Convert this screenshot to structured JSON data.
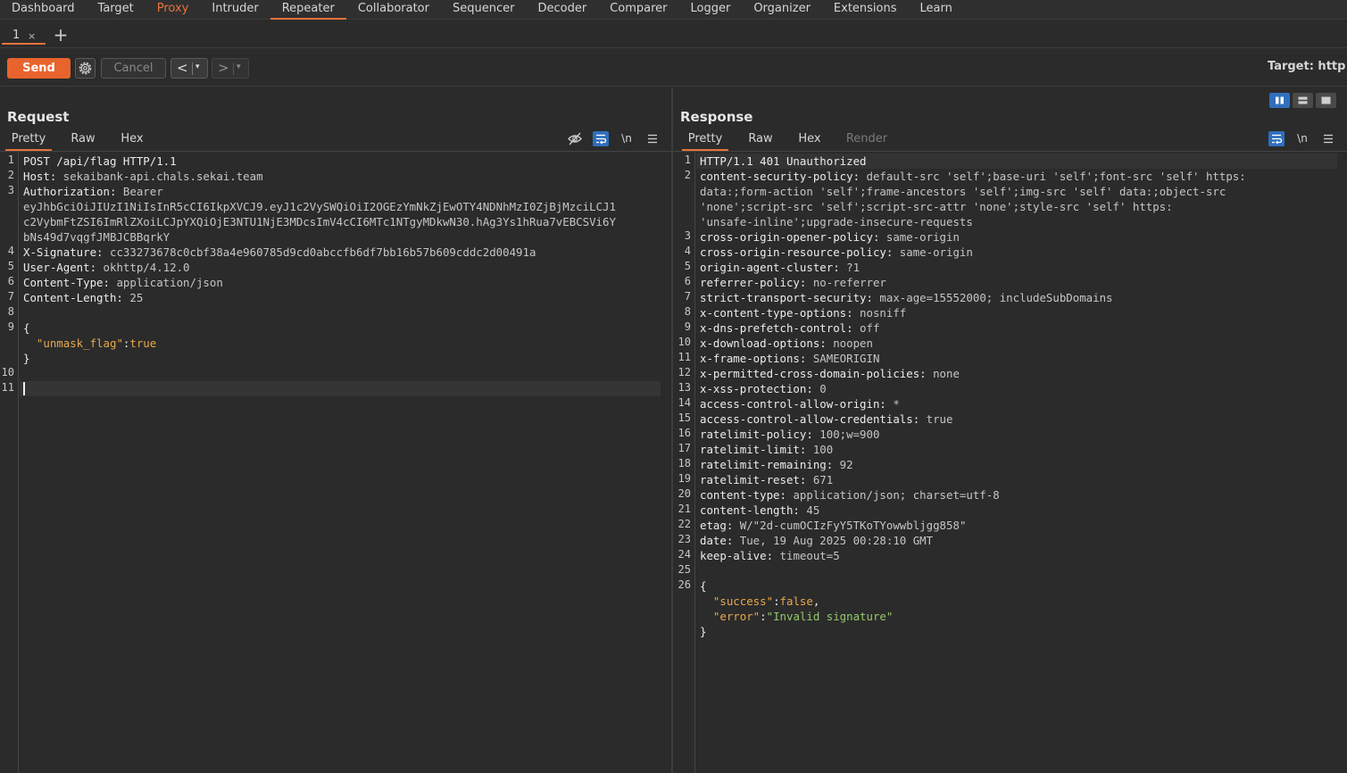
{
  "menu": {
    "items": [
      "Dashboard",
      "Target",
      "Proxy",
      "Intruder",
      "Repeater",
      "Collaborator",
      "Sequencer",
      "Decoder",
      "Comparer",
      "Logger",
      "Organizer",
      "Extensions",
      "Learn"
    ]
  },
  "repeater_tabs": [
    {
      "label": "1",
      "close": "×"
    }
  ],
  "add_tab": "+",
  "toolbar": {
    "send": "Send",
    "cancel": "Cancel",
    "back_arrow": "<",
    "fwd_arrow": ">",
    "dropdown": "▾",
    "target": "Target: http"
  },
  "request": {
    "title": "Request",
    "tabs": [
      "Pretty",
      "Raw",
      "Hex"
    ],
    "newline_label": "\\n",
    "lines": [
      {
        "n": "1",
        "parts": [
          {
            "t": "POST /api/flag HTTP/1.1",
            "c": "k"
          }
        ]
      },
      {
        "n": "2",
        "parts": [
          {
            "t": "Host: ",
            "c": "k"
          },
          {
            "t": "sekaibank-api.chals.sekai.team",
            "c": "v"
          }
        ]
      },
      {
        "n": "3",
        "parts": [
          {
            "t": "Authorization: ",
            "c": "k"
          },
          {
            "t": "Bearer",
            "c": "v"
          }
        ]
      },
      {
        "n": "",
        "parts": [
          {
            "t": "eyJhbGciOiJIUzI1NiIsInR5cCI6IkpXVCJ9.eyJ1c2VySWQiOiI2OGEzYmNkZjEwOTY4NDNhMzI0ZjBjMzciLCJ1",
            "c": "v"
          }
        ]
      },
      {
        "n": "",
        "parts": [
          {
            "t": "c2VybmFtZSI6ImRlZXoiLCJpYXQiOjE3NTU1NjE3MDcsImV4cCI6MTc1NTgyMDkwN30.hAg3Ys1hRua7vEBCSVi6Y",
            "c": "v"
          }
        ]
      },
      {
        "n": "",
        "parts": [
          {
            "t": "bNs49d7vqgfJMBJCBBqrkY",
            "c": "v"
          }
        ]
      },
      {
        "n": "4",
        "parts": [
          {
            "t": "X-Signature: ",
            "c": "k"
          },
          {
            "t": "cc33273678c0cbf38a4e960785d9cd0abccfb6df7bb16b57b609cddc2d00491a",
            "c": "v"
          }
        ]
      },
      {
        "n": "5",
        "parts": [
          {
            "t": "User-Agent: ",
            "c": "k"
          },
          {
            "t": "okhttp/4.12.0",
            "c": "v"
          }
        ]
      },
      {
        "n": "6",
        "parts": [
          {
            "t": "Content-Type: ",
            "c": "k"
          },
          {
            "t": "application/json",
            "c": "v"
          }
        ]
      },
      {
        "n": "7",
        "parts": [
          {
            "t": "Content-Length: ",
            "c": "k"
          },
          {
            "t": "25",
            "c": "v"
          }
        ]
      },
      {
        "n": "8",
        "parts": []
      },
      {
        "n": "9",
        "parts": [
          {
            "t": "{",
            "c": "k"
          }
        ]
      },
      {
        "n": "",
        "parts": [
          {
            "t": "  ",
            "c": "k"
          },
          {
            "t": "\"unmask_flag\"",
            "c": "s"
          },
          {
            "t": ":",
            "c": "k"
          },
          {
            "t": "true",
            "c": "bool"
          }
        ]
      },
      {
        "n": "",
        "parts": [
          {
            "t": "}",
            "c": "k"
          }
        ]
      },
      {
        "n": "10",
        "parts": []
      },
      {
        "n": "11",
        "parts": []
      }
    ]
  },
  "response": {
    "title": "Response",
    "tabs": [
      "Pretty",
      "Raw",
      "Hex",
      "Render"
    ],
    "newline_label": "\\n",
    "lines": [
      {
        "n": "1",
        "parts": [
          {
            "t": "HTTP/1.1 401 Unauthorized",
            "c": "k"
          }
        ]
      },
      {
        "n": "2",
        "parts": [
          {
            "t": "content-security-policy: ",
            "c": "k"
          },
          {
            "t": "default-src 'self';base-uri 'self';font-src 'self' https:",
            "c": "v"
          }
        ]
      },
      {
        "n": "",
        "parts": [
          {
            "t": "data:;form-action 'self';frame-ancestors 'self';img-src 'self' data:;object-src",
            "c": "v"
          }
        ]
      },
      {
        "n": "",
        "parts": [
          {
            "t": "'none';script-src 'self';script-src-attr 'none';style-src 'self' https:",
            "c": "v"
          }
        ]
      },
      {
        "n": "",
        "parts": [
          {
            "t": "'unsafe-inline';upgrade-insecure-requests",
            "c": "v"
          }
        ]
      },
      {
        "n": "3",
        "parts": [
          {
            "t": "cross-origin-opener-policy: ",
            "c": "k"
          },
          {
            "t": "same-origin",
            "c": "v"
          }
        ]
      },
      {
        "n": "4",
        "parts": [
          {
            "t": "cross-origin-resource-policy: ",
            "c": "k"
          },
          {
            "t": "same-origin",
            "c": "v"
          }
        ]
      },
      {
        "n": "5",
        "parts": [
          {
            "t": "origin-agent-cluster: ",
            "c": "k"
          },
          {
            "t": "?1",
            "c": "v"
          }
        ]
      },
      {
        "n": "6",
        "parts": [
          {
            "t": "referrer-policy: ",
            "c": "k"
          },
          {
            "t": "no-referrer",
            "c": "v"
          }
        ]
      },
      {
        "n": "7",
        "parts": [
          {
            "t": "strict-transport-security: ",
            "c": "k"
          },
          {
            "t": "max-age=15552000; includeSubDomains",
            "c": "v"
          }
        ]
      },
      {
        "n": "8",
        "parts": [
          {
            "t": "x-content-type-options: ",
            "c": "k"
          },
          {
            "t": "nosniff",
            "c": "v"
          }
        ]
      },
      {
        "n": "9",
        "parts": [
          {
            "t": "x-dns-prefetch-control: ",
            "c": "k"
          },
          {
            "t": "off",
            "c": "v"
          }
        ]
      },
      {
        "n": "10",
        "parts": [
          {
            "t": "x-download-options: ",
            "c": "k"
          },
          {
            "t": "noopen",
            "c": "v"
          }
        ]
      },
      {
        "n": "11",
        "parts": [
          {
            "t": "x-frame-options: ",
            "c": "k"
          },
          {
            "t": "SAMEORIGIN",
            "c": "v"
          }
        ]
      },
      {
        "n": "12",
        "parts": [
          {
            "t": "x-permitted-cross-domain-policies: ",
            "c": "k"
          },
          {
            "t": "none",
            "c": "v"
          }
        ]
      },
      {
        "n": "13",
        "parts": [
          {
            "t": "x-xss-protection: ",
            "c": "k"
          },
          {
            "t": "0",
            "c": "v"
          }
        ]
      },
      {
        "n": "14",
        "parts": [
          {
            "t": "access-control-allow-origin: ",
            "c": "k"
          },
          {
            "t": "*",
            "c": "v"
          }
        ]
      },
      {
        "n": "15",
        "parts": [
          {
            "t": "access-control-allow-credentials: ",
            "c": "k"
          },
          {
            "t": "true",
            "c": "v"
          }
        ]
      },
      {
        "n": "16",
        "parts": [
          {
            "t": "ratelimit-policy: ",
            "c": "k"
          },
          {
            "t": "100;w=900",
            "c": "v"
          }
        ]
      },
      {
        "n": "17",
        "parts": [
          {
            "t": "ratelimit-limit: ",
            "c": "k"
          },
          {
            "t": "100",
            "c": "v"
          }
        ]
      },
      {
        "n": "18",
        "parts": [
          {
            "t": "ratelimit-remaining: ",
            "c": "k"
          },
          {
            "t": "92",
            "c": "v"
          }
        ]
      },
      {
        "n": "19",
        "parts": [
          {
            "t": "ratelimit-reset: ",
            "c": "k"
          },
          {
            "t": "671",
            "c": "v"
          }
        ]
      },
      {
        "n": "20",
        "parts": [
          {
            "t": "content-type: ",
            "c": "k"
          },
          {
            "t": "application/json; charset=utf-8",
            "c": "v"
          }
        ]
      },
      {
        "n": "21",
        "parts": [
          {
            "t": "content-length: ",
            "c": "k"
          },
          {
            "t": "45",
            "c": "v"
          }
        ]
      },
      {
        "n": "22",
        "parts": [
          {
            "t": "etag: ",
            "c": "k"
          },
          {
            "t": "W/\"2d-cumOCIzFyY5TKoTYowwbljgg858\"",
            "c": "v"
          }
        ]
      },
      {
        "n": "23",
        "parts": [
          {
            "t": "date: ",
            "c": "k"
          },
          {
            "t": "Tue, 19 Aug 2025 00:28:10 GMT",
            "c": "v"
          }
        ]
      },
      {
        "n": "24",
        "parts": [
          {
            "t": "keep-alive: ",
            "c": "k"
          },
          {
            "t": "timeout=5",
            "c": "v"
          }
        ]
      },
      {
        "n": "25",
        "parts": []
      },
      {
        "n": "26",
        "parts": [
          {
            "t": "{",
            "c": "k"
          }
        ]
      },
      {
        "n": "",
        "parts": [
          {
            "t": "  ",
            "c": "k"
          },
          {
            "t": "\"success\"",
            "c": "s"
          },
          {
            "t": ":",
            "c": "k"
          },
          {
            "t": "false",
            "c": "bool"
          },
          {
            "t": ",",
            "c": "k"
          }
        ]
      },
      {
        "n": "",
        "parts": [
          {
            "t": "  ",
            "c": "k"
          },
          {
            "t": "\"error\"",
            "c": "s"
          },
          {
            "t": ":",
            "c": "k"
          },
          {
            "t": "\"Invalid signature\"",
            "c": "str"
          }
        ]
      },
      {
        "n": "",
        "parts": [
          {
            "t": "}",
            "c": "k"
          }
        ]
      }
    ]
  },
  "colors": {
    "accent": "#e8733a",
    "send_button": "#e8642c",
    "active_toggle": "#2f6fbd",
    "json_key": "#e8a84c",
    "json_string": "#95c86b"
  }
}
